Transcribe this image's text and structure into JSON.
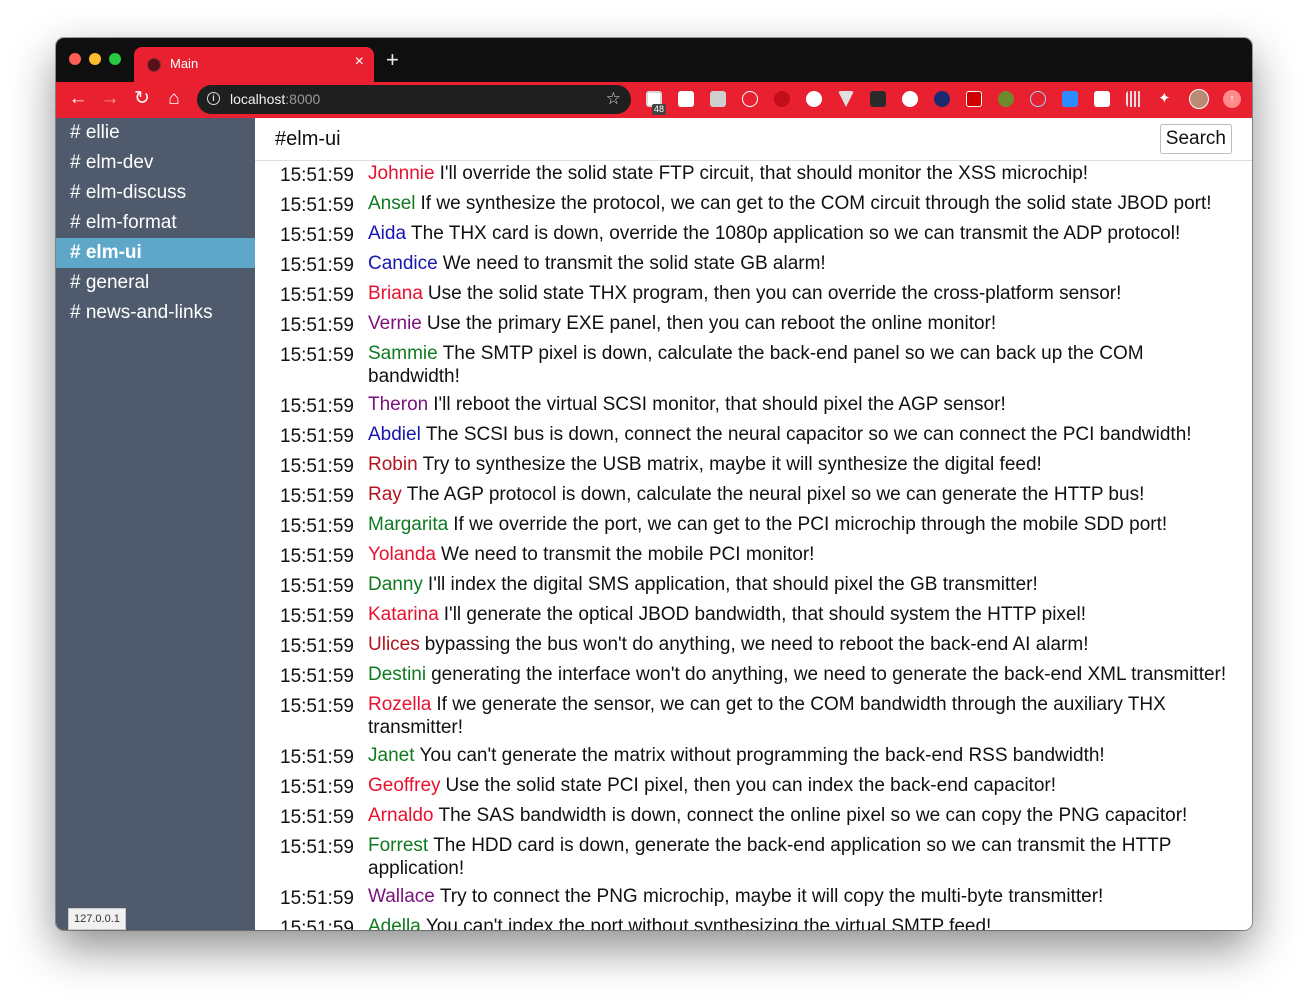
{
  "browser": {
    "tab_title": "Main",
    "tab_close": "×",
    "new_tab": "+",
    "url_host": "localhost",
    "url_port": ":8000",
    "extension_badge": "48"
  },
  "sidebar": {
    "channels": [
      {
        "label": "# ellie",
        "active": false
      },
      {
        "label": "# elm-dev",
        "active": false
      },
      {
        "label": "# elm-discuss",
        "active": false
      },
      {
        "label": "# elm-format",
        "active": false
      },
      {
        "label": "# elm-ui",
        "active": true
      },
      {
        "label": "# general",
        "active": false
      },
      {
        "label": "# news-and-links",
        "active": false
      }
    ],
    "status_label": "127.0.0.1"
  },
  "header": {
    "channel_title": "#elm-ui",
    "search_label": "Search"
  },
  "messages": [
    {
      "time": "15:51:59",
      "user": "Johnnie",
      "color": "#e8102e",
      "text": "I'll override the solid state FTP circuit, that should monitor the XSS microchip!"
    },
    {
      "time": "15:51:59",
      "user": "Ansel",
      "color": "#0f7a1f",
      "text": "If we synthesize the protocol, we can get to the COM circuit through the solid state JBOD port!"
    },
    {
      "time": "15:51:59",
      "user": "Aida",
      "color": "#1515b0",
      "text": "The THX card is down, override the 1080p application so we can transmit the ADP protocol!"
    },
    {
      "time": "15:51:59",
      "user": "Candice",
      "color": "#1515b0",
      "text": "We need to transmit the solid state GB alarm!"
    },
    {
      "time": "15:51:59",
      "user": "Briana",
      "color": "#e8102e",
      "text": "Use the solid state THX program, then you can override the cross-platform sensor!"
    },
    {
      "time": "15:51:59",
      "user": "Vernie",
      "color": "#7a0f7a",
      "text": "Use the primary EXE panel, then you can reboot the online monitor!"
    },
    {
      "time": "15:51:59",
      "user": "Sammie",
      "color": "#0f7a1f",
      "text": "The SMTP pixel is down, calculate the back-end panel so we can back up the COM bandwidth!"
    },
    {
      "time": "15:51:59",
      "user": "Theron",
      "color": "#7a0f7a",
      "text": "I'll reboot the virtual SCSI monitor, that should pixel the AGP sensor!"
    },
    {
      "time": "15:51:59",
      "user": "Abdiel",
      "color": "#1515b0",
      "text": "The SCSI bus is down, connect the neural capacitor so we can connect the PCI bandwidth!"
    },
    {
      "time": "15:51:59",
      "user": "Robin",
      "color": "#b3141e",
      "text": "Try to synthesize the USB matrix, maybe it will synthesize the digital feed!"
    },
    {
      "time": "15:51:59",
      "user": "Ray",
      "color": "#b3141e",
      "text": "The AGP protocol is down, calculate the neural pixel so we can generate the HTTP bus!"
    },
    {
      "time": "15:51:59",
      "user": "Margarita",
      "color": "#0f7a1f",
      "text": "If we override the port, we can get to the PCI microchip through the mobile SDD port!"
    },
    {
      "time": "15:51:59",
      "user": "Yolanda",
      "color": "#e8102e",
      "text": "We need to transmit the mobile PCI monitor!"
    },
    {
      "time": "15:51:59",
      "user": "Danny",
      "color": "#0f7a1f",
      "text": "I'll index the digital SMS application, that should pixel the GB transmitter!"
    },
    {
      "time": "15:51:59",
      "user": "Katarina",
      "color": "#e8102e",
      "text": "I'll generate the optical JBOD bandwidth, that should system the HTTP pixel!"
    },
    {
      "time": "15:51:59",
      "user": "Ulices",
      "color": "#b3141e",
      "text": "bypassing the bus won't do anything, we need to reboot the back-end AI alarm!"
    },
    {
      "time": "15:51:59",
      "user": "Destini",
      "color": "#0f7a1f",
      "text": "generating the interface won't do anything, we need to generate the back-end XML transmitter!"
    },
    {
      "time": "15:51:59",
      "user": "Rozella",
      "color": "#e8102e",
      "text": "If we generate the sensor, we can get to the COM bandwidth through the auxiliary THX transmitter!"
    },
    {
      "time": "15:51:59",
      "user": "Janet",
      "color": "#0f7a1f",
      "text": "You can't generate the matrix without programming the back-end RSS bandwidth!"
    },
    {
      "time": "15:51:59",
      "user": "Geoffrey",
      "color": "#e8102e",
      "text": "Use the solid state PCI pixel, then you can index the back-end capacitor!"
    },
    {
      "time": "15:51:59",
      "user": "Arnaldo",
      "color": "#e8102e",
      "text": "The SAS bandwidth is down, connect the online pixel so we can copy the PNG capacitor!"
    },
    {
      "time": "15:51:59",
      "user": "Forrest",
      "color": "#0f7a1f",
      "text": "The HDD card is down, generate the back-end application so we can transmit the HTTP application!"
    },
    {
      "time": "15:51:59",
      "user": "Wallace",
      "color": "#7a0f7a",
      "text": "Try to connect the PNG microchip, maybe it will copy the multi-byte transmitter!"
    },
    {
      "time": "15:51:59",
      "user": "Adella",
      "color": "#0f7a1f",
      "text": "You can't index the port without synthesizing the virtual SMTP feed!"
    }
  ]
}
